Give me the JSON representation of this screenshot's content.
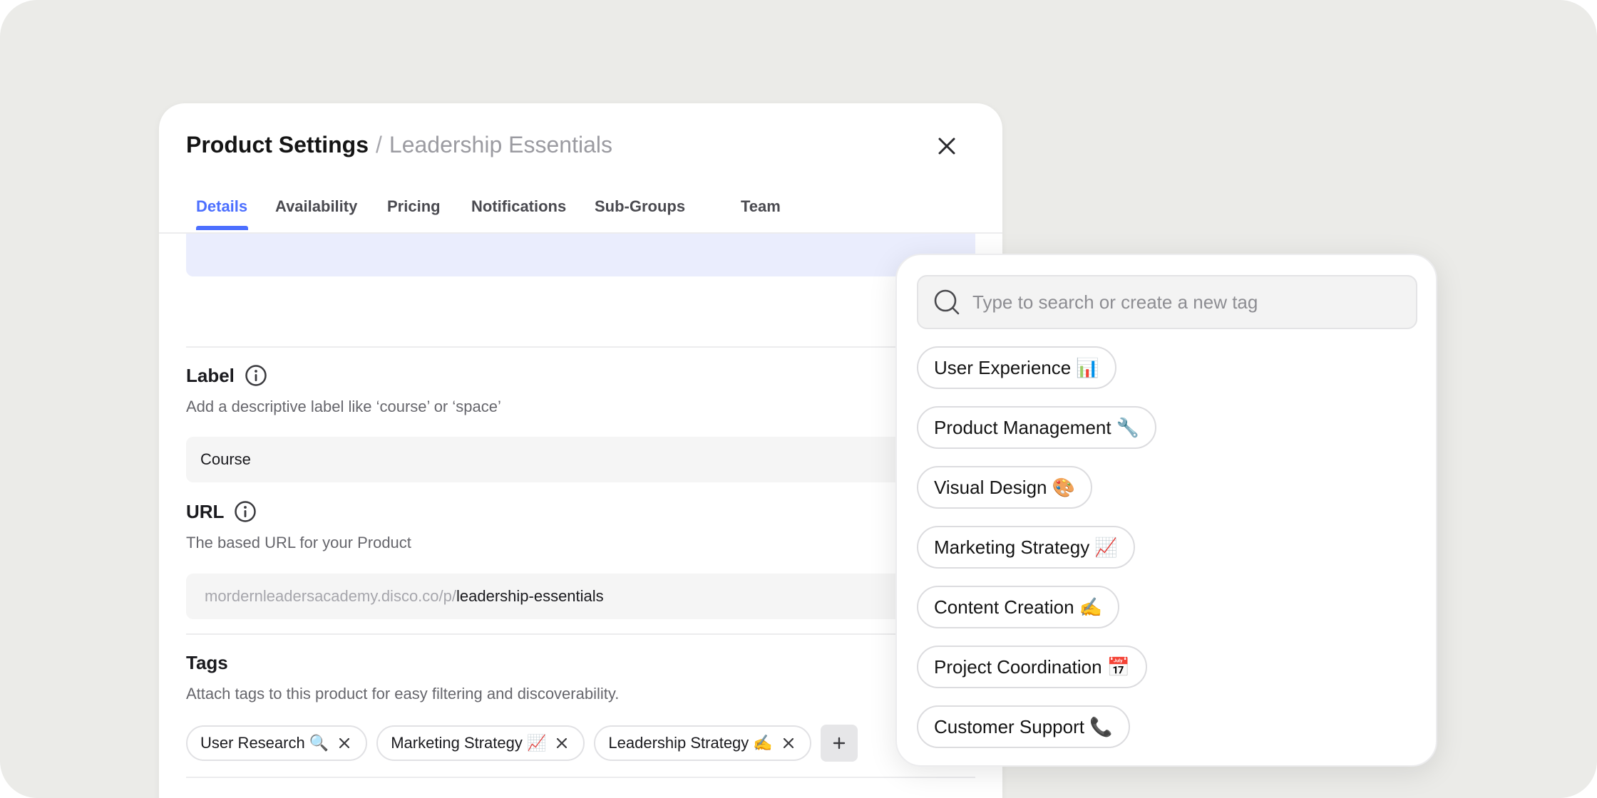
{
  "modal": {
    "title": "Product Settings",
    "separator": "/",
    "subtitle": "Leadership Essentials"
  },
  "tabs": [
    {
      "label": "Details",
      "active": true
    },
    {
      "label": "Availability",
      "active": false
    },
    {
      "label": "Pricing",
      "active": false
    },
    {
      "label": "Notifications",
      "active": false
    },
    {
      "label": "Sub-Groups",
      "active": false
    },
    {
      "label": "Team",
      "active": false
    }
  ],
  "label_section": {
    "title": "Label",
    "description": "Add a descriptive label like ‘course’ or ‘space’",
    "value": "Course"
  },
  "url_section": {
    "title": "URL",
    "description": "The based URL for your Product",
    "prefix": "mordernleadersacademy.disco.co/p/",
    "slug": "leadership-essentials"
  },
  "tags_section": {
    "title": "Tags",
    "description": "Attach tags to this product for easy filtering and discoverability.",
    "tags": [
      "User Research 🔍",
      "Marketing Strategy 📈",
      "Leadership Strategy ✍️"
    ],
    "add_label": "+"
  },
  "tag_dropdown": {
    "search_placeholder": "Type to search or create a new tag",
    "options": [
      "User Experience 📊",
      "Product Management 🔧",
      "Visual Design 🎨",
      "Marketing Strategy 📈",
      "Content Creation ✍️",
      "Project Coordination 📅",
      "Customer Support 📞"
    ]
  },
  "colors": {
    "accent": "#4c6fff",
    "background": "#ebebe8",
    "banner": "#eaedfd"
  },
  "icons": {
    "close": "close-icon",
    "info": "info-icon",
    "remove": "remove-tag-icon",
    "search": "search-icon",
    "add": "plus-icon"
  }
}
